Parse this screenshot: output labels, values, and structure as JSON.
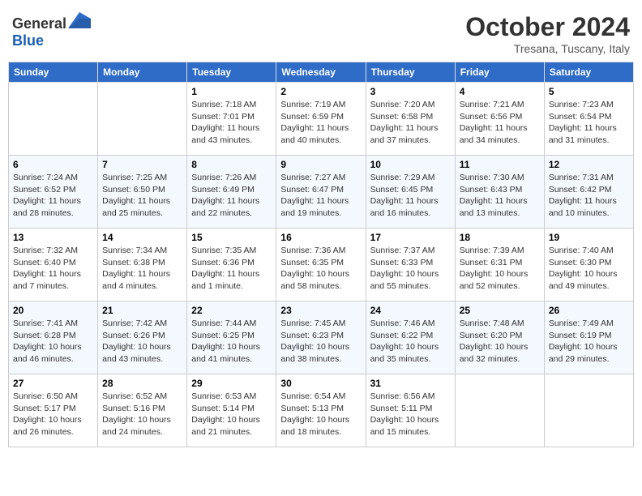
{
  "header": {
    "logo_general": "General",
    "logo_blue": "Blue",
    "month_year": "October 2024",
    "location": "Tresana, Tuscany, Italy"
  },
  "days_of_week": [
    "Sunday",
    "Monday",
    "Tuesday",
    "Wednesday",
    "Thursday",
    "Friday",
    "Saturday"
  ],
  "weeks": [
    [
      {
        "day": "",
        "info": ""
      },
      {
        "day": "",
        "info": ""
      },
      {
        "day": "1",
        "info": "Sunrise: 7:18 AM\nSunset: 7:01 PM\nDaylight: 11 hours and 43 minutes."
      },
      {
        "day": "2",
        "info": "Sunrise: 7:19 AM\nSunset: 6:59 PM\nDaylight: 11 hours and 40 minutes."
      },
      {
        "day": "3",
        "info": "Sunrise: 7:20 AM\nSunset: 6:58 PM\nDaylight: 11 hours and 37 minutes."
      },
      {
        "day": "4",
        "info": "Sunrise: 7:21 AM\nSunset: 6:56 PM\nDaylight: 11 hours and 34 minutes."
      },
      {
        "day": "5",
        "info": "Sunrise: 7:23 AM\nSunset: 6:54 PM\nDaylight: 11 hours and 31 minutes."
      }
    ],
    [
      {
        "day": "6",
        "info": "Sunrise: 7:24 AM\nSunset: 6:52 PM\nDaylight: 11 hours and 28 minutes."
      },
      {
        "day": "7",
        "info": "Sunrise: 7:25 AM\nSunset: 6:50 PM\nDaylight: 11 hours and 25 minutes."
      },
      {
        "day": "8",
        "info": "Sunrise: 7:26 AM\nSunset: 6:49 PM\nDaylight: 11 hours and 22 minutes."
      },
      {
        "day": "9",
        "info": "Sunrise: 7:27 AM\nSunset: 6:47 PM\nDaylight: 11 hours and 19 minutes."
      },
      {
        "day": "10",
        "info": "Sunrise: 7:29 AM\nSunset: 6:45 PM\nDaylight: 11 hours and 16 minutes."
      },
      {
        "day": "11",
        "info": "Sunrise: 7:30 AM\nSunset: 6:43 PM\nDaylight: 11 hours and 13 minutes."
      },
      {
        "day": "12",
        "info": "Sunrise: 7:31 AM\nSunset: 6:42 PM\nDaylight: 11 hours and 10 minutes."
      }
    ],
    [
      {
        "day": "13",
        "info": "Sunrise: 7:32 AM\nSunset: 6:40 PM\nDaylight: 11 hours and 7 minutes."
      },
      {
        "day": "14",
        "info": "Sunrise: 7:34 AM\nSunset: 6:38 PM\nDaylight: 11 hours and 4 minutes."
      },
      {
        "day": "15",
        "info": "Sunrise: 7:35 AM\nSunset: 6:36 PM\nDaylight: 11 hours and 1 minute."
      },
      {
        "day": "16",
        "info": "Sunrise: 7:36 AM\nSunset: 6:35 PM\nDaylight: 10 hours and 58 minutes."
      },
      {
        "day": "17",
        "info": "Sunrise: 7:37 AM\nSunset: 6:33 PM\nDaylight: 10 hours and 55 minutes."
      },
      {
        "day": "18",
        "info": "Sunrise: 7:39 AM\nSunset: 6:31 PM\nDaylight: 10 hours and 52 minutes."
      },
      {
        "day": "19",
        "info": "Sunrise: 7:40 AM\nSunset: 6:30 PM\nDaylight: 10 hours and 49 minutes."
      }
    ],
    [
      {
        "day": "20",
        "info": "Sunrise: 7:41 AM\nSunset: 6:28 PM\nDaylight: 10 hours and 46 minutes."
      },
      {
        "day": "21",
        "info": "Sunrise: 7:42 AM\nSunset: 6:26 PM\nDaylight: 10 hours and 43 minutes."
      },
      {
        "day": "22",
        "info": "Sunrise: 7:44 AM\nSunset: 6:25 PM\nDaylight: 10 hours and 41 minutes."
      },
      {
        "day": "23",
        "info": "Sunrise: 7:45 AM\nSunset: 6:23 PM\nDaylight: 10 hours and 38 minutes."
      },
      {
        "day": "24",
        "info": "Sunrise: 7:46 AM\nSunset: 6:22 PM\nDaylight: 10 hours and 35 minutes."
      },
      {
        "day": "25",
        "info": "Sunrise: 7:48 AM\nSunset: 6:20 PM\nDaylight: 10 hours and 32 minutes."
      },
      {
        "day": "26",
        "info": "Sunrise: 7:49 AM\nSunset: 6:19 PM\nDaylight: 10 hours and 29 minutes."
      }
    ],
    [
      {
        "day": "27",
        "info": "Sunrise: 6:50 AM\nSunset: 5:17 PM\nDaylight: 10 hours and 26 minutes."
      },
      {
        "day": "28",
        "info": "Sunrise: 6:52 AM\nSunset: 5:16 PM\nDaylight: 10 hours and 24 minutes."
      },
      {
        "day": "29",
        "info": "Sunrise: 6:53 AM\nSunset: 5:14 PM\nDaylight: 10 hours and 21 minutes."
      },
      {
        "day": "30",
        "info": "Sunrise: 6:54 AM\nSunset: 5:13 PM\nDaylight: 10 hours and 18 minutes."
      },
      {
        "day": "31",
        "info": "Sunrise: 6:56 AM\nSunset: 5:11 PM\nDaylight: 10 hours and 15 minutes."
      },
      {
        "day": "",
        "info": ""
      },
      {
        "day": "",
        "info": ""
      }
    ]
  ]
}
